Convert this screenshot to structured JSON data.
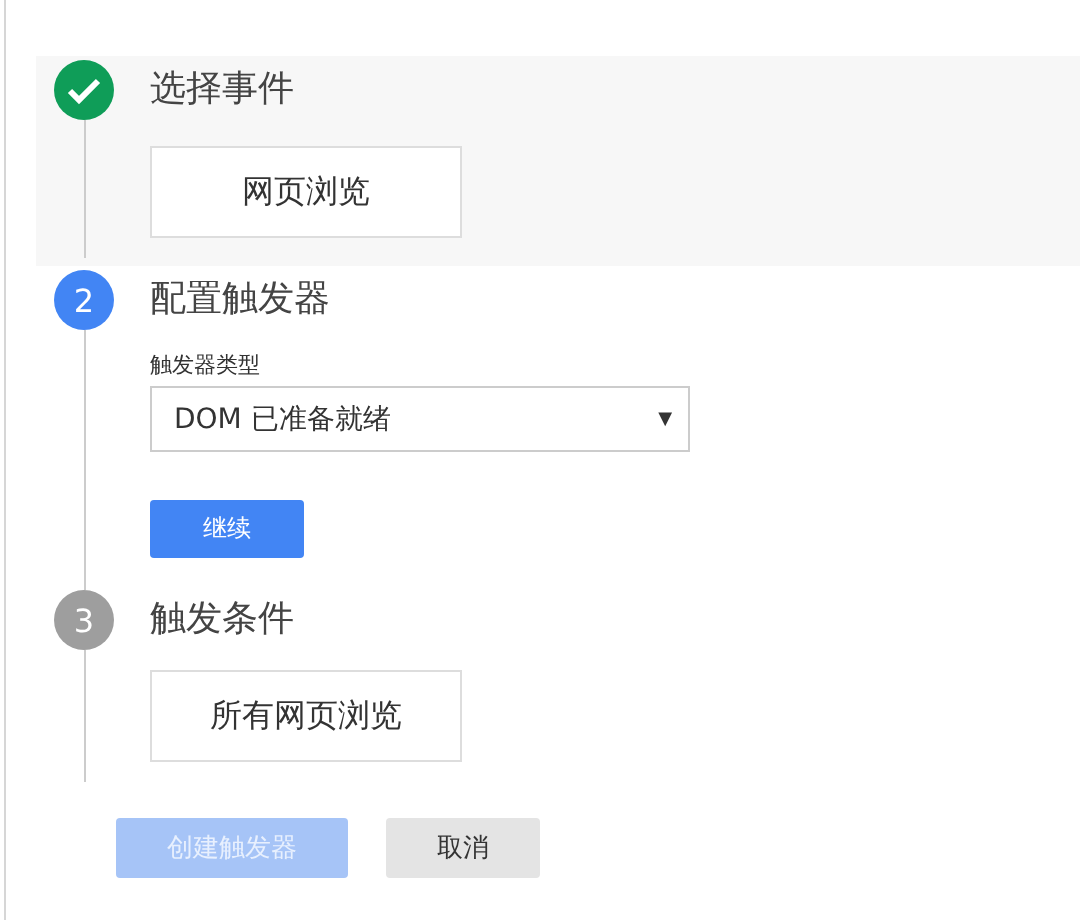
{
  "steps": [
    {
      "kind": "done",
      "title": "选择事件",
      "highlighted": true,
      "content": {
        "kind": "chip",
        "label": "网页浏览"
      }
    },
    {
      "kind": "active",
      "number": "2",
      "title": "配置触发器",
      "highlighted": false,
      "content": {
        "kind": "form",
        "field_label": "触发器类型",
        "select_value": "DOM 已准备就绪",
        "caret": "▼",
        "button": "继续"
      }
    },
    {
      "kind": "pending",
      "number": "3",
      "title": "触发条件",
      "highlighted": false,
      "content": {
        "kind": "chip",
        "label": "所有网页浏览"
      }
    }
  ],
  "actions": [
    {
      "label": "创建触发器",
      "kind": "primary",
      "disabled": true
    },
    {
      "label": "取消",
      "kind": "secondary",
      "disabled": false
    }
  ]
}
